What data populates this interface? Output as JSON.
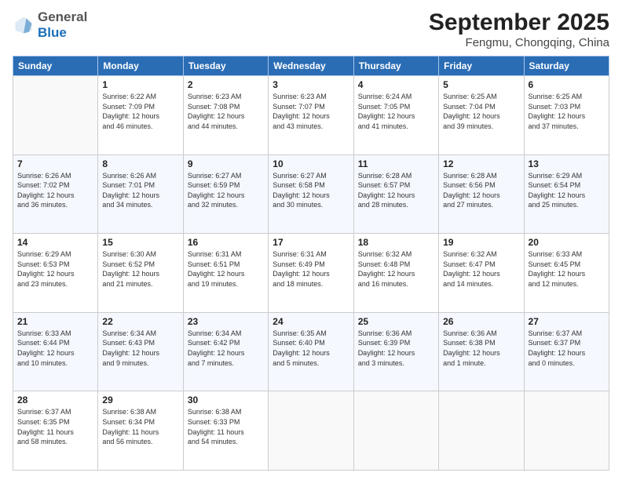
{
  "header": {
    "logo": {
      "line1": "General",
      "line2": "Blue"
    },
    "title": "September 2025",
    "location": "Fengmu, Chongqing, China"
  },
  "columns": [
    "Sunday",
    "Monday",
    "Tuesday",
    "Wednesday",
    "Thursday",
    "Friday",
    "Saturday"
  ],
  "weeks": [
    [
      {
        "day": "",
        "info": ""
      },
      {
        "day": "1",
        "info": "Sunrise: 6:22 AM\nSunset: 7:09 PM\nDaylight: 12 hours\nand 46 minutes."
      },
      {
        "day": "2",
        "info": "Sunrise: 6:23 AM\nSunset: 7:08 PM\nDaylight: 12 hours\nand 44 minutes."
      },
      {
        "day": "3",
        "info": "Sunrise: 6:23 AM\nSunset: 7:07 PM\nDaylight: 12 hours\nand 43 minutes."
      },
      {
        "day": "4",
        "info": "Sunrise: 6:24 AM\nSunset: 7:05 PM\nDaylight: 12 hours\nand 41 minutes."
      },
      {
        "day": "5",
        "info": "Sunrise: 6:25 AM\nSunset: 7:04 PM\nDaylight: 12 hours\nand 39 minutes."
      },
      {
        "day": "6",
        "info": "Sunrise: 6:25 AM\nSunset: 7:03 PM\nDaylight: 12 hours\nand 37 minutes."
      }
    ],
    [
      {
        "day": "7",
        "info": "Sunrise: 6:26 AM\nSunset: 7:02 PM\nDaylight: 12 hours\nand 36 minutes."
      },
      {
        "day": "8",
        "info": "Sunrise: 6:26 AM\nSunset: 7:01 PM\nDaylight: 12 hours\nand 34 minutes."
      },
      {
        "day": "9",
        "info": "Sunrise: 6:27 AM\nSunset: 6:59 PM\nDaylight: 12 hours\nand 32 minutes."
      },
      {
        "day": "10",
        "info": "Sunrise: 6:27 AM\nSunset: 6:58 PM\nDaylight: 12 hours\nand 30 minutes."
      },
      {
        "day": "11",
        "info": "Sunrise: 6:28 AM\nSunset: 6:57 PM\nDaylight: 12 hours\nand 28 minutes."
      },
      {
        "day": "12",
        "info": "Sunrise: 6:28 AM\nSunset: 6:56 PM\nDaylight: 12 hours\nand 27 minutes."
      },
      {
        "day": "13",
        "info": "Sunrise: 6:29 AM\nSunset: 6:54 PM\nDaylight: 12 hours\nand 25 minutes."
      }
    ],
    [
      {
        "day": "14",
        "info": "Sunrise: 6:29 AM\nSunset: 6:53 PM\nDaylight: 12 hours\nand 23 minutes."
      },
      {
        "day": "15",
        "info": "Sunrise: 6:30 AM\nSunset: 6:52 PM\nDaylight: 12 hours\nand 21 minutes."
      },
      {
        "day": "16",
        "info": "Sunrise: 6:31 AM\nSunset: 6:51 PM\nDaylight: 12 hours\nand 19 minutes."
      },
      {
        "day": "17",
        "info": "Sunrise: 6:31 AM\nSunset: 6:49 PM\nDaylight: 12 hours\nand 18 minutes."
      },
      {
        "day": "18",
        "info": "Sunrise: 6:32 AM\nSunset: 6:48 PM\nDaylight: 12 hours\nand 16 minutes."
      },
      {
        "day": "19",
        "info": "Sunrise: 6:32 AM\nSunset: 6:47 PM\nDaylight: 12 hours\nand 14 minutes."
      },
      {
        "day": "20",
        "info": "Sunrise: 6:33 AM\nSunset: 6:45 PM\nDaylight: 12 hours\nand 12 minutes."
      }
    ],
    [
      {
        "day": "21",
        "info": "Sunrise: 6:33 AM\nSunset: 6:44 PM\nDaylight: 12 hours\nand 10 minutes."
      },
      {
        "day": "22",
        "info": "Sunrise: 6:34 AM\nSunset: 6:43 PM\nDaylight: 12 hours\nand 9 minutes."
      },
      {
        "day": "23",
        "info": "Sunrise: 6:34 AM\nSunset: 6:42 PM\nDaylight: 12 hours\nand 7 minutes."
      },
      {
        "day": "24",
        "info": "Sunrise: 6:35 AM\nSunset: 6:40 PM\nDaylight: 12 hours\nand 5 minutes."
      },
      {
        "day": "25",
        "info": "Sunrise: 6:36 AM\nSunset: 6:39 PM\nDaylight: 12 hours\nand 3 minutes."
      },
      {
        "day": "26",
        "info": "Sunrise: 6:36 AM\nSunset: 6:38 PM\nDaylight: 12 hours\nand 1 minute."
      },
      {
        "day": "27",
        "info": "Sunrise: 6:37 AM\nSunset: 6:37 PM\nDaylight: 12 hours\nand 0 minutes."
      }
    ],
    [
      {
        "day": "28",
        "info": "Sunrise: 6:37 AM\nSunset: 6:35 PM\nDaylight: 11 hours\nand 58 minutes."
      },
      {
        "day": "29",
        "info": "Sunrise: 6:38 AM\nSunset: 6:34 PM\nDaylight: 11 hours\nand 56 minutes."
      },
      {
        "day": "30",
        "info": "Sunrise: 6:38 AM\nSunset: 6:33 PM\nDaylight: 11 hours\nand 54 minutes."
      },
      {
        "day": "",
        "info": ""
      },
      {
        "day": "",
        "info": ""
      },
      {
        "day": "",
        "info": ""
      },
      {
        "day": "",
        "info": ""
      }
    ]
  ]
}
